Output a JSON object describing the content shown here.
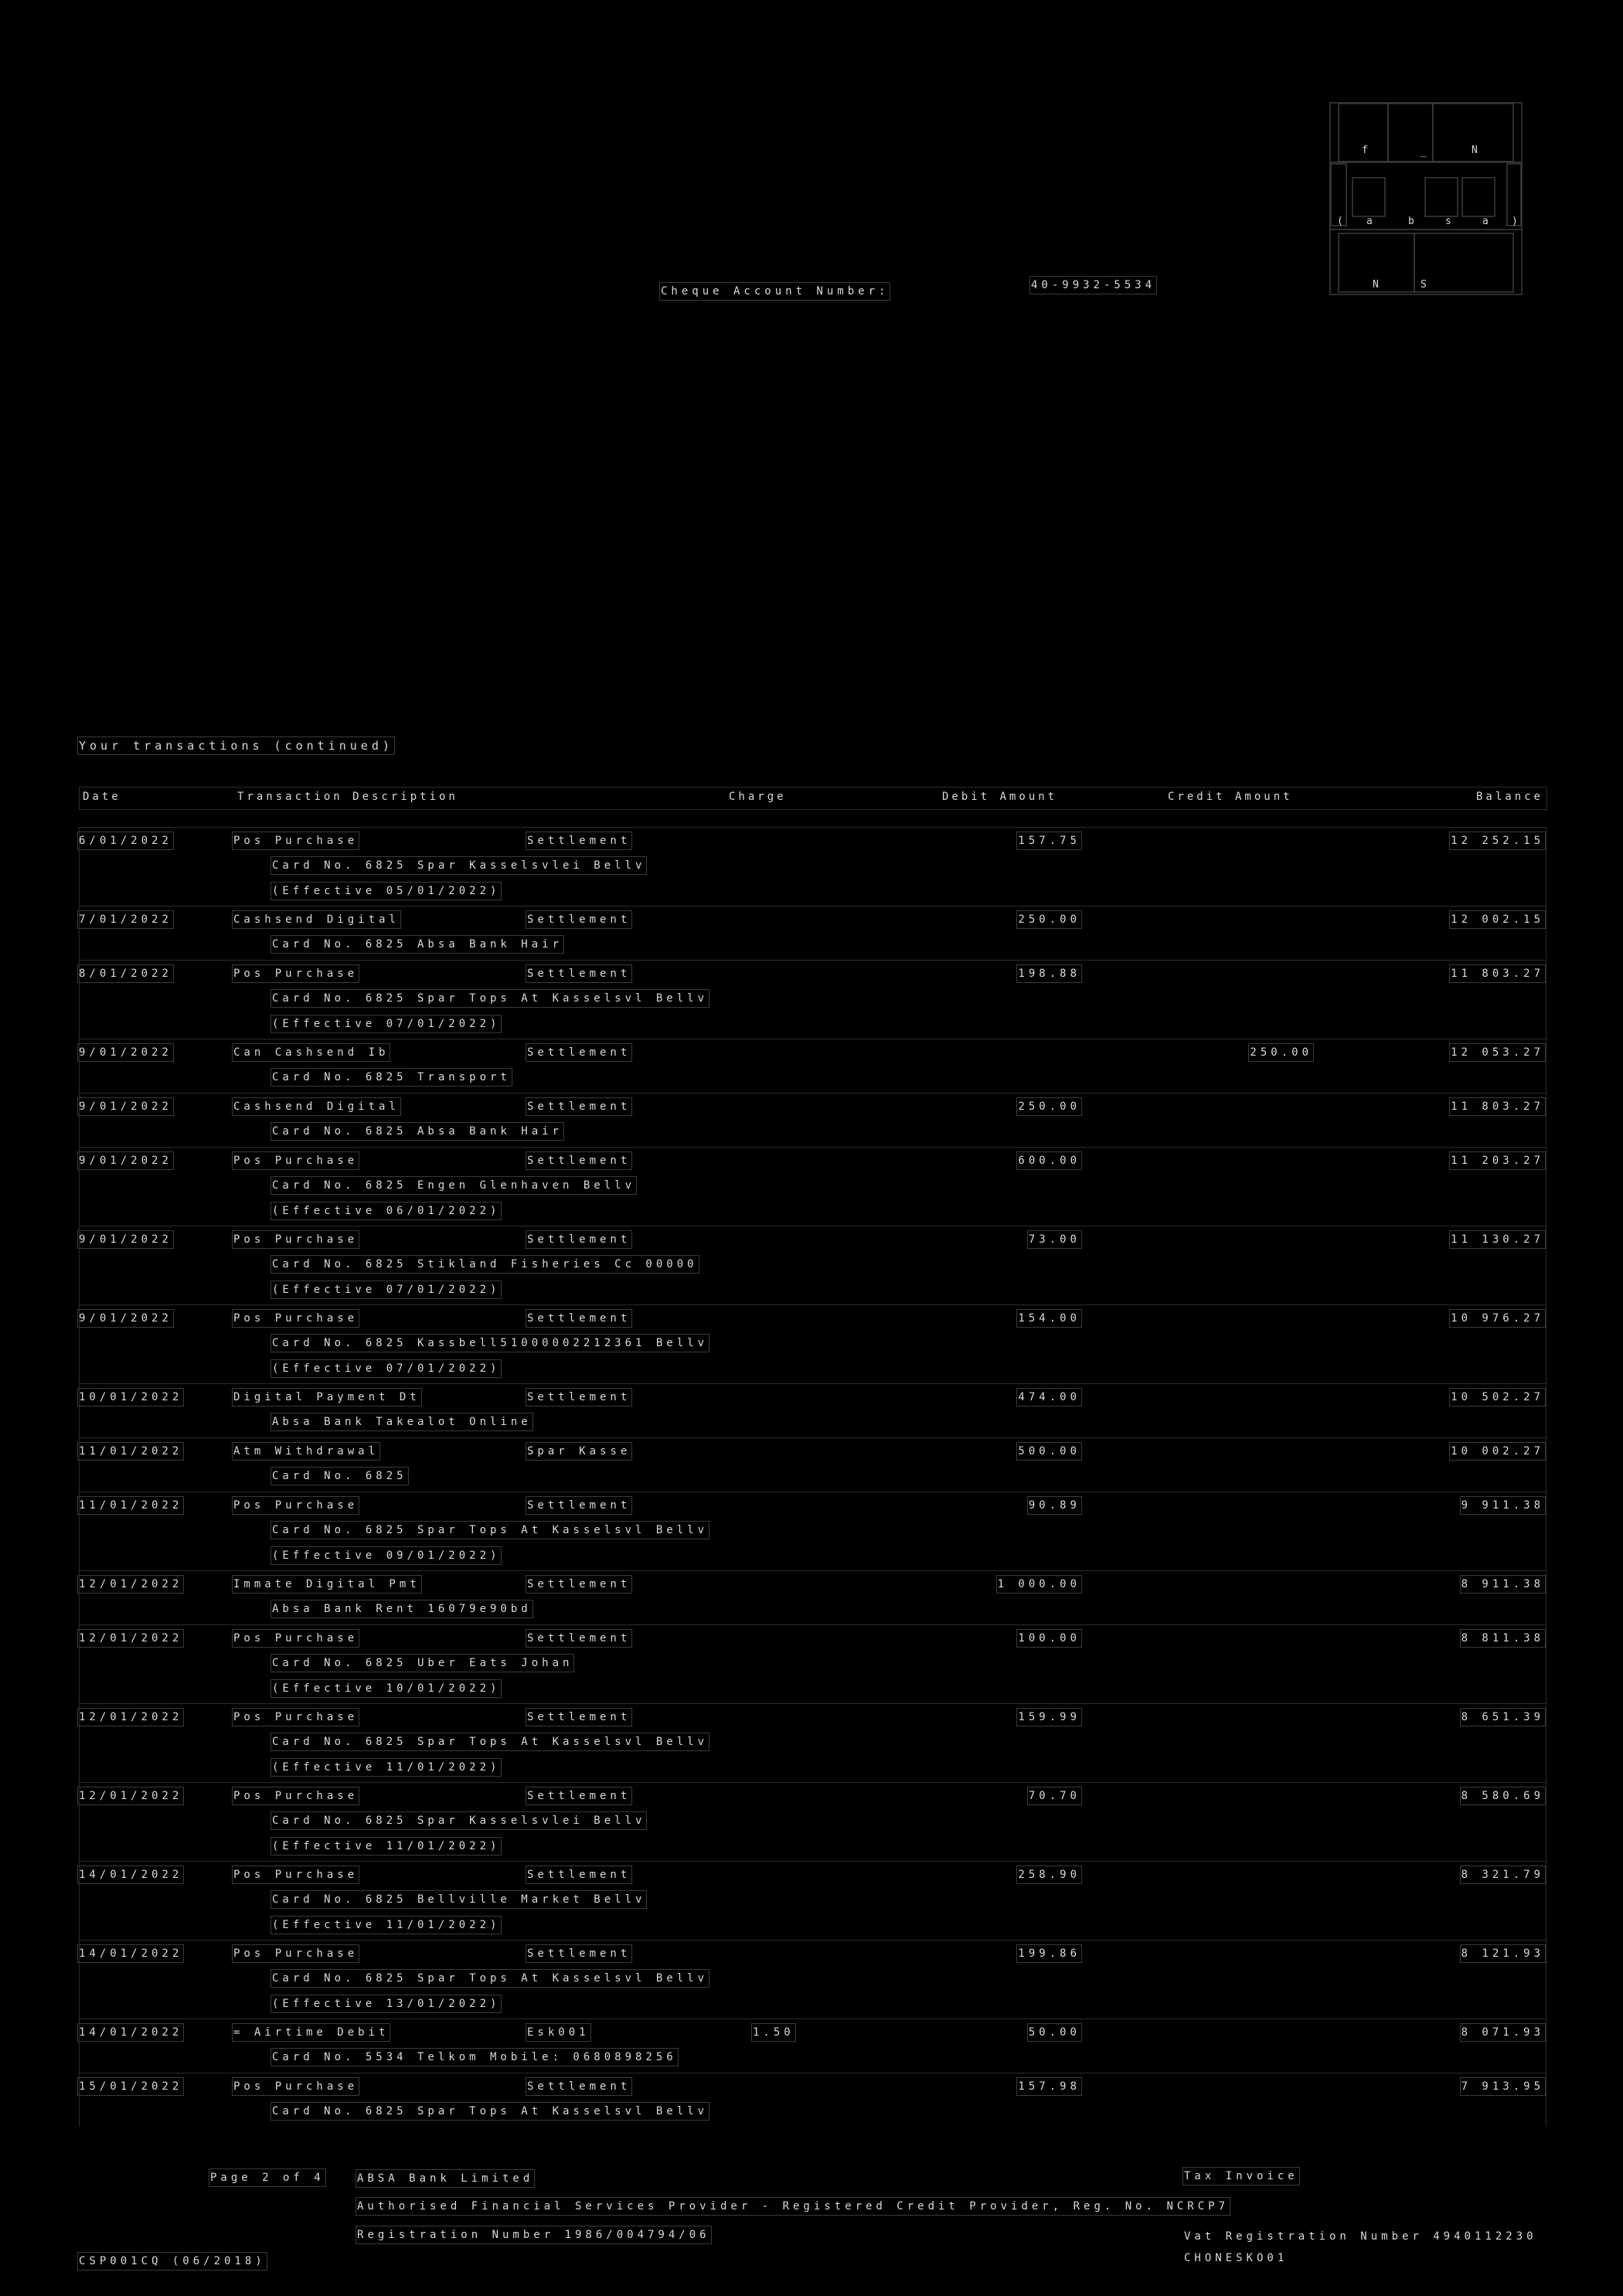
{
  "logo": {
    "top_letters": [
      "f",
      "_",
      "N"
    ],
    "mid_letters": [
      "(",
      "a",
      "b",
      "s",
      "a",
      ")"
    ],
    "bottom_letters": [
      "N",
      "S"
    ]
  },
  "account": {
    "label": "Cheque Account Number:",
    "number": "40-9932-5534"
  },
  "section_title": "Your transactions (continued)",
  "columns": {
    "date": "Date",
    "description": "Transaction Description",
    "charge": "Charge",
    "debit": "Debit Amount",
    "credit": "Credit Amount",
    "balance": "Balance"
  },
  "transactions": [
    {
      "date": "6/01/2022",
      "desc": "Pos Purchase",
      "ref": "Settlement",
      "charge": "",
      "debit": "157.75",
      "credit": "",
      "balance": "12 252.15",
      "lines": [
        "Card No. 6825 Spar Kasselsvlei        Bellv",
        "(Effective 05/01/2022)"
      ]
    },
    {
      "date": "7/01/2022",
      "desc": "Cashsend Digital",
      "ref": "Settlement",
      "charge": "",
      "debit": "250.00",
      "credit": "",
      "balance": "12 002.15",
      "lines": [
        "Card No. 6825 Absa Bank Hair"
      ]
    },
    {
      "date": "8/01/2022",
      "desc": "Pos Purchase",
      "ref": "Settlement",
      "charge": "",
      "debit": "198.88",
      "credit": "",
      "balance": "11 803.27",
      "lines": [
        "Card No. 6825 Spar Tops At Kasselsvl  Bellv",
        "(Effective 07/01/2022)"
      ]
    },
    {
      "date": "9/01/2022",
      "desc": "Can Cashsend Ib",
      "ref": "Settlement",
      "charge": "",
      "debit": "",
      "credit": "250.00",
      "balance": "12 053.27",
      "lines": [
        "Card No. 6825        Transport"
      ]
    },
    {
      "date": "9/01/2022",
      "desc": "Cashsend Digital",
      "ref": "Settlement",
      "charge": "",
      "debit": "250.00",
      "credit": "",
      "balance": "11 803.27",
      "lines": [
        "Card No. 6825 Absa Bank Hair"
      ]
    },
    {
      "date": "9/01/2022",
      "desc": "Pos Purchase",
      "ref": "Settlement",
      "charge": "",
      "debit": "600.00",
      "credit": "",
      "balance": "11 203.27",
      "lines": [
        "Card No. 6825 Engen Glenhaven       Bellv",
        "(Effective 06/01/2022)"
      ]
    },
    {
      "date": "9/01/2022",
      "desc": "Pos Purchase",
      "ref": "Settlement",
      "charge": "",
      "debit": "73.00",
      "credit": "",
      "balance": "11 130.27",
      "lines": [
        "Card No. 6825 Stikland Fisheries Cc  00000",
        "(Effective 07/01/2022)"
      ]
    },
    {
      "date": "9/01/2022",
      "desc": "Pos Purchase",
      "ref": "Settlement",
      "charge": "",
      "debit": "154.00",
      "credit": "",
      "balance": "10 976.27",
      "lines": [
        "Card No. 6825 Kassbell51000002212361 Bellv",
        "(Effective 07/01/2022)"
      ]
    },
    {
      "date": "10/01/2022",
      "desc": "Digital Payment Dt",
      "ref": "Settlement",
      "charge": "",
      "debit": "474.00",
      "credit": "",
      "balance": "10 502.27",
      "lines": [
        "Absa Bank Takealot Online"
      ]
    },
    {
      "date": "11/01/2022",
      "desc": "Atm Withdrawal",
      "ref": "Spar Kasse",
      "charge": "",
      "debit": "500.00",
      "credit": "",
      "balance": "10 002.27",
      "lines": [
        "Card No. 6825"
      ]
    },
    {
      "date": "11/01/2022",
      "desc": "Pos Purchase",
      "ref": "Settlement",
      "charge": "",
      "debit": "90.89",
      "credit": "",
      "balance": "9 911.38",
      "lines": [
        "Card No. 6825 Spar Tops At Kasselsvl  Bellv",
        "(Effective 09/01/2022)"
      ]
    },
    {
      "date": "12/01/2022",
      "desc": "Immate Digital Pmt",
      "ref": "Settlement",
      "charge": "",
      "debit": "1 000.00",
      "credit": "",
      "balance": "8 911.38",
      "lines": [
        "Absa Bank Rent         16079e90bd"
      ]
    },
    {
      "date": "12/01/2022",
      "desc": "Pos Purchase",
      "ref": "Settlement",
      "charge": "",
      "debit": "100.00",
      "credit": "",
      "balance": "8 811.38",
      "lines": [
        "Card No. 6825 Uber Eats         Johan",
        "(Effective 10/01/2022)"
      ]
    },
    {
      "date": "12/01/2022",
      "desc": "Pos Purchase",
      "ref": "Settlement",
      "charge": "",
      "debit": "159.99",
      "credit": "",
      "balance": "8 651.39",
      "lines": [
        "Card No. 6825 Spar Tops At Kasselsvl  Bellv",
        "(Effective 11/01/2022)"
      ]
    },
    {
      "date": "12/01/2022",
      "desc": "Pos Purchase",
      "ref": "Settlement",
      "charge": "",
      "debit": "70.70",
      "credit": "",
      "balance": "8 580.69",
      "lines": [
        "Card No. 6825 Spar Kasselsvlei        Bellv",
        "(Effective 11/01/2022)"
      ]
    },
    {
      "date": "14/01/2022",
      "desc": "Pos Purchase",
      "ref": "Settlement",
      "charge": "",
      "debit": "258.90",
      "credit": "",
      "balance": "8 321.79",
      "lines": [
        "Card No. 6825 Bellville Market       Bellv",
        "(Effective 11/01/2022)"
      ]
    },
    {
      "date": "14/01/2022",
      "desc": "Pos Purchase",
      "ref": "Settlement",
      "charge": "",
      "debit": "199.86",
      "credit": "",
      "balance": "8 121.93",
      "lines": [
        "Card No. 6825 Spar Tops At Kasselsvl  Bellv",
        "(Effective 13/01/2022)"
      ]
    },
    {
      "date": "14/01/2022",
      "desc": "= Airtime Debit",
      "ref": "Esk001",
      "charge": "1.50",
      "debit": "50.00",
      "credit": "",
      "balance": "8 071.93",
      "lines": [
        "Card No. 5534 Telkom Mobile: 0680898256"
      ]
    },
    {
      "date": "15/01/2022",
      "desc": "Pos Purchase",
      "ref": "Settlement",
      "charge": "",
      "debit": "157.98",
      "credit": "",
      "balance": "7 913.95",
      "lines": [
        "Card No. 6825 Spar Tops At Kasselsvl  Bellv"
      ]
    }
  ],
  "footer": {
    "page": "Page 2 of 4",
    "bank": "ABSA Bank Limited",
    "fsp": "Authorised Financial Services Provider - Registered Credit Provider, Reg. No. NCRCP7",
    "reg": "Registration Number 1986/004794/06",
    "tax": "Tax Invoice",
    "vat": "Vat Registration Number 4940112230",
    "code": "CHONESKO01",
    "form": "CSP001CQ (06/2018)"
  }
}
